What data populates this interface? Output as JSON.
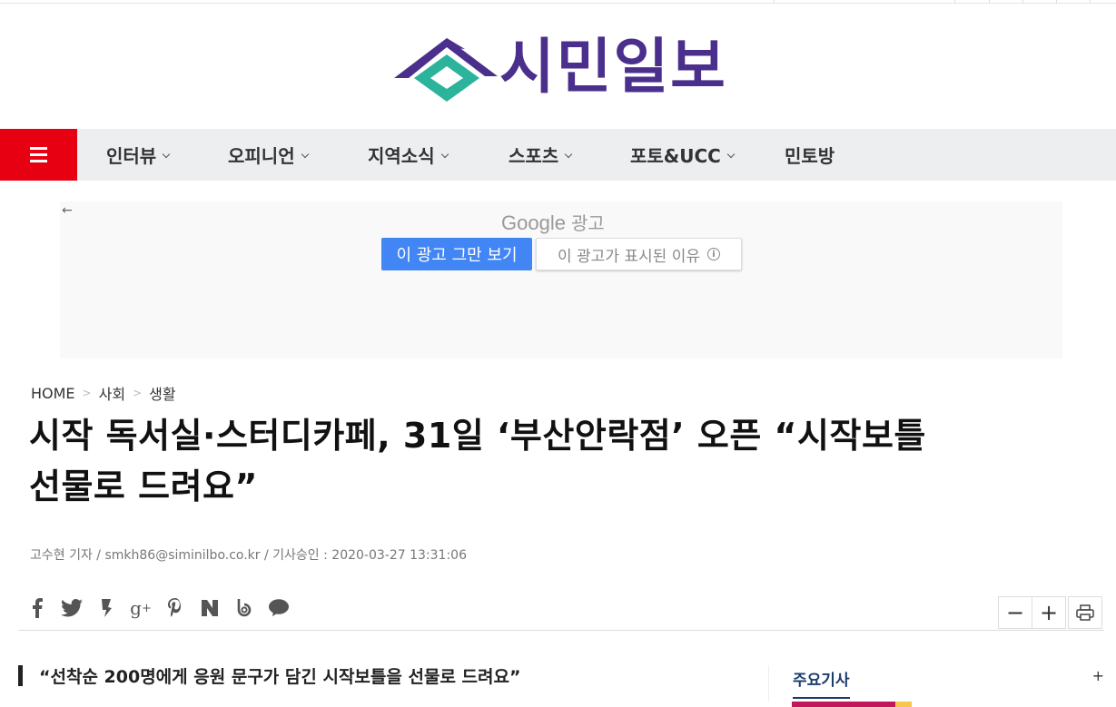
{
  "site": {
    "name": "시민일보",
    "brand_color": "#4a2f8c",
    "accent_color": "#2bb39c"
  },
  "nav": {
    "menu_icon": "hamburger-menu-icon",
    "items": [
      {
        "label": "인터뷰",
        "has_dropdown": true
      },
      {
        "label": "오피니언",
        "has_dropdown": true
      },
      {
        "label": "지역소식",
        "has_dropdown": true
      },
      {
        "label": "스포츠",
        "has_dropdown": true
      },
      {
        "label": "포토&UCC",
        "has_dropdown": true
      },
      {
        "label": "민토방",
        "has_dropdown": false
      }
    ]
  },
  "ad": {
    "back_icon": "arrow-left-icon",
    "provider": "Google",
    "provider_label": "광고",
    "stop_label": "이 광고 그만 보기",
    "why_label": "이 광고가 표시된 이유",
    "why_icon": "info-icon"
  },
  "breadcrumb": {
    "home": "HOME",
    "section": "사회",
    "current": "생활"
  },
  "article": {
    "title_line1": "시작 독서실·스터디카페, 31일 ‘부산안락점’ 오픈 “시작보틀",
    "title_line2": "선물로 드려요”",
    "byline": "고수현 기자 / smkh86@siminilbo.co.kr / 기사승인 : 2020-03-27 13:31:06",
    "subheading": "“선착순 200명에게 응원 문구가 담긴 시작보틀을 선물로 드려요”"
  },
  "share": [
    "facebook-icon",
    "twitter-icon",
    "kakaostory-icon",
    "googleplus-icon",
    "pinterest-icon",
    "naver-icon",
    "band-icon",
    "kakaotalk-icon"
  ],
  "tools": {
    "decrease": "−",
    "increase": "+",
    "print_icon": "printer-icon"
  },
  "sidebar": {
    "title": "주요기사",
    "more": "+"
  }
}
